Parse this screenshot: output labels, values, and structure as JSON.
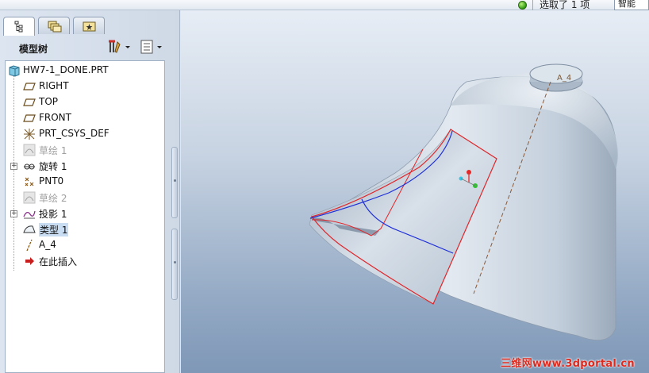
{
  "statusbar": {
    "selection_text": "选取了 1 项",
    "filter_value": "智能"
  },
  "left_panel": {
    "tabs": [
      {
        "icon": "model-tree-tab-icon"
      },
      {
        "icon": "folder-browser-tab-icon"
      },
      {
        "icon": "favorites-tab-icon"
      }
    ],
    "title": "模型树",
    "settings_icon": "settings-tools-icon",
    "show_icon": "show-list-icon"
  },
  "tree": {
    "root": "HW7-1_DONE.PRT",
    "items": [
      {
        "label": "RIGHT",
        "icon": "datum-plane-icon",
        "dim": false
      },
      {
        "label": "TOP",
        "icon": "datum-plane-icon",
        "dim": false
      },
      {
        "label": "FRONT",
        "icon": "datum-plane-icon",
        "dim": false
      },
      {
        "label": "PRT_CSYS_DEF",
        "icon": "csys-icon",
        "dim": false
      },
      {
        "label": "草绘 1",
        "icon": "sketch-icon",
        "dim": true
      },
      {
        "label": "旋转 1",
        "icon": "revolve-icon",
        "dim": false
      },
      {
        "label": "PNT0",
        "icon": "datum-point-icon",
        "dim": false
      },
      {
        "label": "草绘 2",
        "icon": "sketch-icon",
        "dim": true
      },
      {
        "label": "投影 1",
        "icon": "projection-icon",
        "dim": false
      },
      {
        "label": "类型 1",
        "icon": "surface-icon",
        "dim": false,
        "selected": true
      },
      {
        "label": "A_4",
        "icon": "datum-axis-icon",
        "dim": false
      },
      {
        "label": "在此插入",
        "icon": "insert-arrow-icon",
        "dim": false
      }
    ]
  },
  "viewport": {
    "axis_label": "A_4",
    "watermark": "三维网www.3dportal.cn"
  }
}
